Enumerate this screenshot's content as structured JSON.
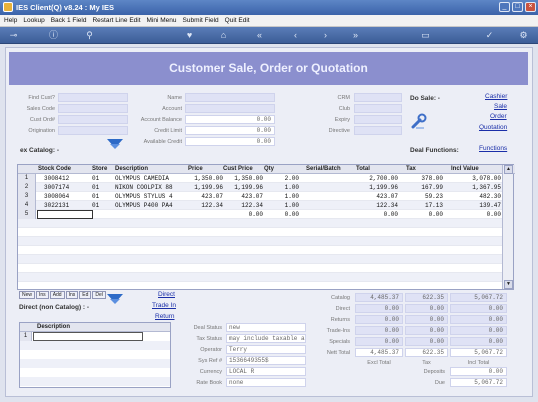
{
  "window": {
    "title": "IES Client(Q) v8.24 : My IES"
  },
  "menu": [
    "Help",
    "Lookup",
    "Back 1 Field",
    "Restart Line Edit",
    "Mini Menu",
    "Submit Field",
    "Quit Edit"
  ],
  "toolbar_icons": [
    "key-icon",
    "info-icon",
    "search-icon",
    "heart-icon",
    "home-icon",
    "first-icon",
    "prev-icon",
    "next-icon",
    "last-icon",
    "open-icon",
    "check-icon",
    "settings-icon"
  ],
  "header": {
    "title": "Customer Sale, Order or Quotation"
  },
  "left_form": {
    "find_cust": "Find Cust?",
    "sales_code": "Sales Code",
    "cust_ord": "Cust Ord#",
    "origination": "Origination",
    "name": "Name",
    "account": "Account",
    "account_balance": "Account Balance",
    "credit_limit": "Credit Limit",
    "available_credit": "Available Credit",
    "account_balance_val": "0.00",
    "credit_limit_val": "0.00",
    "available_credit_val": "0.00",
    "crm": "CRM",
    "club": "Club",
    "expiry": "Expiry",
    "directive": "Directive"
  },
  "do_sale": {
    "label": "Do Sale: -",
    "links": [
      "Cashier",
      "Sale",
      "Order",
      "Quotation"
    ]
  },
  "ex_catalog": "ex Catalog: -",
  "deal_functions": {
    "label": "Deal Functions:",
    "link": "Functions"
  },
  "grid": {
    "columns": [
      "Stock Code",
      "Store",
      "Description",
      "Price",
      "Cust Price",
      "Qty",
      "Serial/Batch",
      "Total",
      "Tax",
      "Incl Value"
    ],
    "rows": [
      {
        "n": "1",
        "code": "3008412",
        "store": "01",
        "desc": "OLYMPUS CAMEDIA",
        "price": "1,350.00",
        "cust": "1,350.00",
        "qty": "2.00",
        "serial": "",
        "total": "2,700.00",
        "tax": "378.00",
        "incl": "3,078.00"
      },
      {
        "n": "2",
        "code": "3007174",
        "store": "01",
        "desc": "NIKON COOLPIX 88",
        "price": "1,199.96",
        "cust": "1,199.96",
        "qty": "1.00",
        "serial": "",
        "total": "1,199.96",
        "tax": "167.99",
        "incl": "1,367.95"
      },
      {
        "n": "3",
        "code": "3008064",
        "store": "01",
        "desc": "OLYMPUS STYLUS 4",
        "price": "423.07",
        "cust": "423.07",
        "qty": "1.00",
        "serial": "",
        "total": "423.07",
        "tax": "59.23",
        "incl": "482.30"
      },
      {
        "n": "4",
        "code": "3022131",
        "store": "01",
        "desc": "OLYMPUS P400 PA4",
        "price": "122.34",
        "cust": "122.34",
        "qty": "1.00",
        "serial": "",
        "total": "122.34",
        "tax": "17.13",
        "incl": "139.47"
      },
      {
        "n": "5",
        "code": "",
        "store": "",
        "desc": "",
        "price": "",
        "cust": "0.00",
        "qty": "0.00",
        "serial": "",
        "total": "0.00",
        "tax": "0.00",
        "incl": "0.00"
      }
    ]
  },
  "tab_buttons": [
    "New",
    "Ins",
    "Add",
    "Ins",
    "Ed",
    "Del"
  ],
  "direct_links": [
    "Direct",
    "Trade In",
    "Return"
  ],
  "direct_section": "Direct (non Catalog) : -",
  "mini_grid": {
    "column": "Description",
    "row": "1"
  },
  "deal_info": {
    "deal_status": "Deal Status",
    "deal_status_val": "new",
    "tax_status": "Tax Status",
    "tax_status_val": "may include taxable and",
    "operator": "Operator",
    "operator_val": "Terry",
    "sys_ref": "Sys Ref #",
    "sys_ref_val": "1536649355$",
    "currency": "Currency",
    "currency_val": "LOCAL R",
    "rate_book": "Rate Book",
    "rate_book_val": "none"
  },
  "totals": {
    "labels": [
      "Catalog",
      "Direct",
      "Returns",
      "Trade-Ins",
      "Specials",
      "Nett Total"
    ],
    "excl": [
      "4,485.37",
      "0.00",
      "0.00",
      "0.00",
      "0.00",
      "4,485.37"
    ],
    "tax": [
      "622.35",
      "0.00",
      "0.00",
      "0.00",
      "0.00",
      "622.35"
    ],
    "incl": [
      "5,067.72",
      "0.00",
      "0.00",
      "0.00",
      "0.00",
      "5,067.72"
    ],
    "footer": [
      "Excl Total",
      "Tax",
      "Incl Total"
    ],
    "deposits": "Deposits",
    "deposits_val": "0.00",
    "due": "Due",
    "due_val": "5,067.72"
  }
}
